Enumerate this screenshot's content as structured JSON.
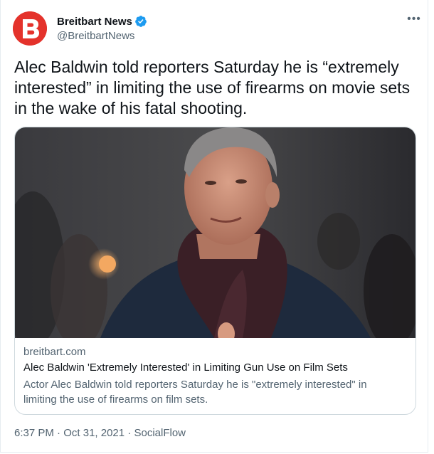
{
  "author": {
    "display_name": "Breitbart News",
    "handle": "@BreitbartNews",
    "avatar_letter": "B",
    "avatar_color": "#e4322b",
    "verified_icon": "verified-badge-icon",
    "verified_color": "#1d9bf0"
  },
  "more_menu_icon": "more-horizontal-icon",
  "tweet": {
    "text": "Alec Baldwin told reporters Saturday he is “extremely interested” in limiting the use of firearms on movie sets in the wake of his fatal shooting."
  },
  "card": {
    "image_alt": "Photo of Alec Baldwin wearing a dark scarf and coat",
    "domain": "breitbart.com",
    "title": "Alec Baldwin 'Extremely Interested' in Limiting Gun Use on Film Sets",
    "description": "Actor Alec Baldwin told reporters Saturday he is \"extremely interested\" in limiting the use of firearms on film sets."
  },
  "meta": {
    "time": "6:37 PM",
    "separator": "·",
    "date": "Oct 31, 2021",
    "source": "SocialFlow"
  }
}
